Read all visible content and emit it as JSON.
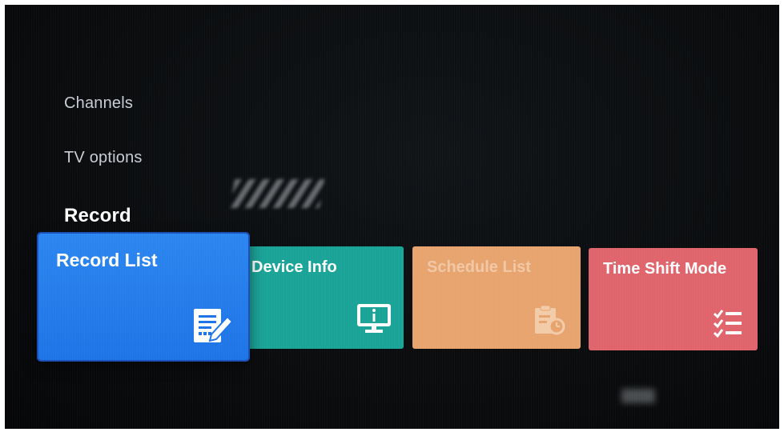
{
  "menu": {
    "items": [
      {
        "label": "Channels"
      },
      {
        "label": "TV options"
      },
      {
        "label": "Record"
      }
    ],
    "selected": "Record"
  },
  "tiles": [
    {
      "label": "Record List",
      "icon": "edit-document-icon",
      "color": "#1e74e6",
      "focused": true
    },
    {
      "label": "Device Info",
      "icon": "monitor-info-icon",
      "color": "#1aa397"
    },
    {
      "label": "Schedule List",
      "icon": "clipboard-clock-icon",
      "color": "#e8a46f",
      "disabled": true
    },
    {
      "label": "Time Shift Mode",
      "icon": "checklist-icon",
      "color": "#e0646c"
    }
  ]
}
